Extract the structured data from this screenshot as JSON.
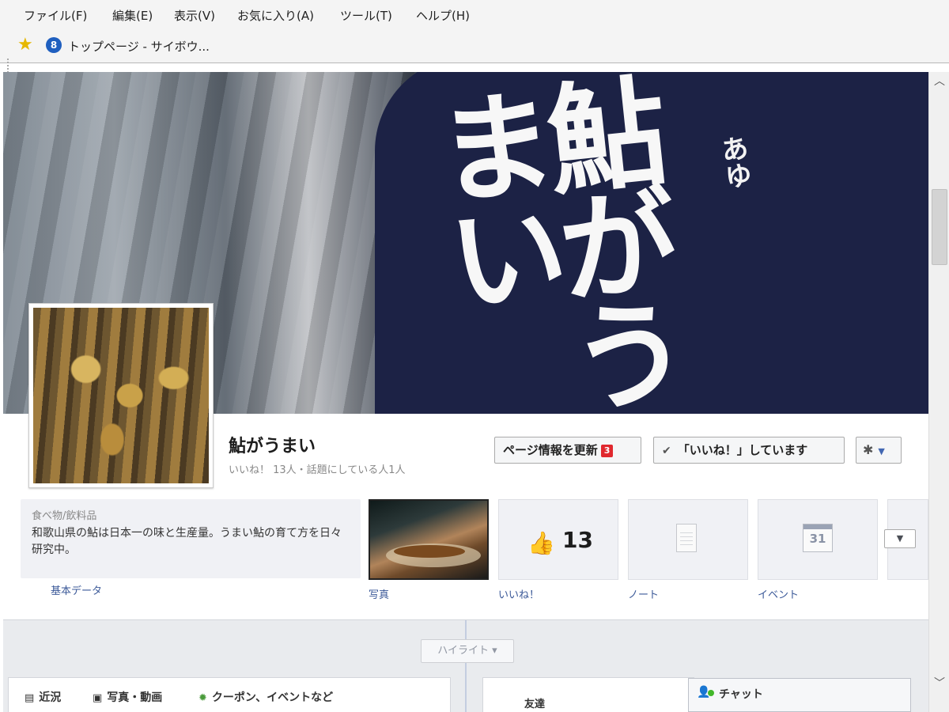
{
  "browser": {
    "menu": [
      "ファイル(F)",
      "編集(E)",
      "表示(V)",
      "お気に入り(A)",
      "ツール(T)",
      "ヘルプ(H)"
    ],
    "favorite_label": "トップページ - サイボウ...",
    "site_icon_text": "8"
  },
  "cover": {
    "main_text": "鮎がうまい",
    "small_text": "あゆ"
  },
  "page": {
    "name": "鮎がうまい",
    "stats": "いいね！ 13人・話題にしている人1人",
    "update_button": "ページ情報を更新",
    "update_badge": "3",
    "liked_button": "「いいね！」しています",
    "gear_symbol": "✱",
    "caret_symbol": "▼"
  },
  "about": {
    "category": "食べ物/飲料品",
    "description": "和歌山県の鮎は日本一の味と生産量。うまい鮎の育て方を日々研究中。",
    "label": "基本データ"
  },
  "tiles": {
    "photos_label": "写真",
    "likes_count": "13",
    "likes_label": "いいね！",
    "notes_label": "ノート",
    "events_label": "イベント",
    "calendar_day": "31",
    "more_symbol": "▼"
  },
  "timeline": {
    "highlight_label": "ハイライト ▾",
    "tab_recent": "近況",
    "tab_photo": "写真・動画",
    "tab_coupon": "クーポン、イベントなど",
    "friends_label": "友達",
    "chat_label": "チャット"
  }
}
